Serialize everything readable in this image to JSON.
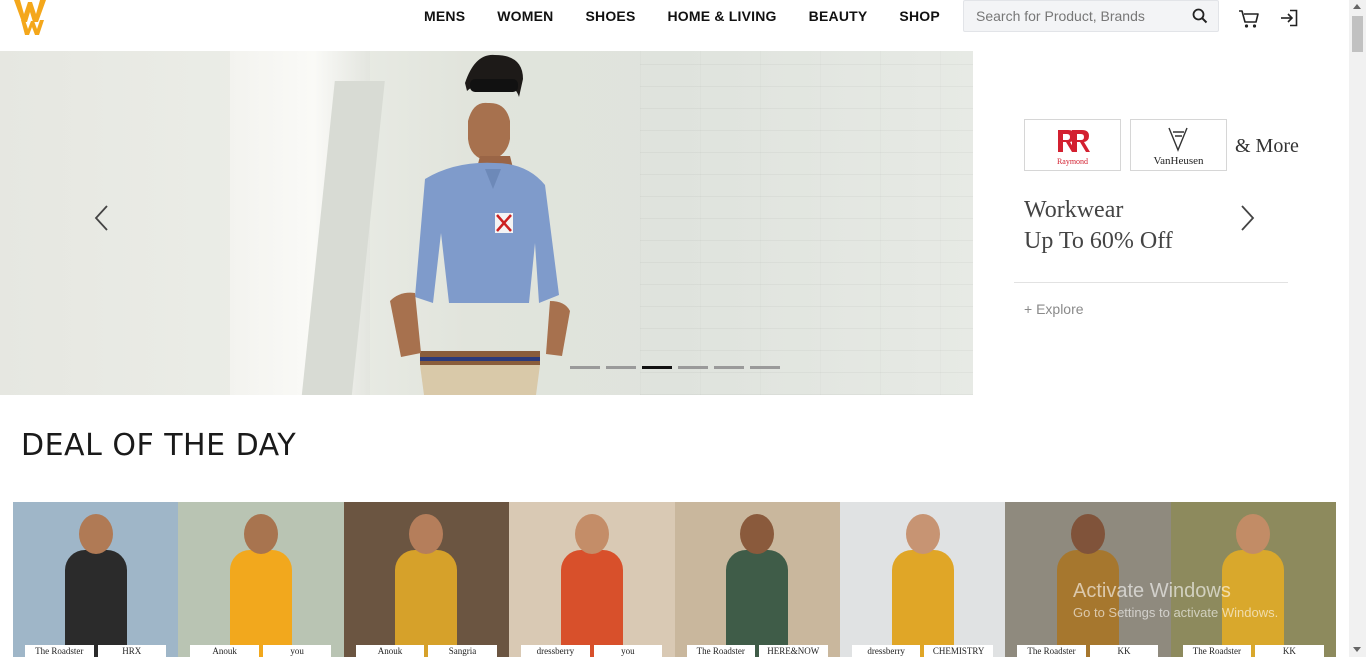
{
  "header": {
    "nav": [
      "MENS",
      "WOMEN",
      "SHOES",
      "HOME & LIVING",
      "BEAUTY",
      "SHOP"
    ],
    "search_placeholder": "Search for Product, Brands",
    "icons": [
      "ww-logo-icon",
      "search-icon",
      "cart-icon",
      "login-icon"
    ]
  },
  "hero": {
    "slide_index": 3,
    "slide_count": 6,
    "promo": {
      "brands": [
        "Raymond",
        "VanHeusen"
      ],
      "more": "& More",
      "title_line1": "Workwear",
      "title_line2": "Up To 60% Off",
      "explore": "+ Explore"
    }
  },
  "deal": {
    "title": "DEAL OF THE DAY",
    "products": [
      {
        "logos": [
          "The Roadster",
          "HRX"
        ],
        "bg": "#9fb6c8",
        "top": "#2b2b2b",
        "skin": "#b07a55"
      },
      {
        "logos": [
          "Anouk",
          "you"
        ],
        "bg": "#b9c4b3",
        "top": "#f2a81d",
        "skin": "#a8744f"
      },
      {
        "logos": [
          "Anouk",
          "Sangria"
        ],
        "bg": "#6b5541",
        "top": "#d6a12a",
        "skin": "#b57e5b"
      },
      {
        "logos": [
          "dressberry",
          "you"
        ],
        "bg": "#d9c9b4",
        "top": "#d8502b",
        "skin": "#c48d68"
      },
      {
        "logos": [
          "The Roadster",
          "HERE&NOW"
        ],
        "bg": "#c9b79d",
        "top": "#3f5c48",
        "skin": "#8a5a3c"
      },
      {
        "logos": [
          "dressberry",
          "CHEMISTRY"
        ],
        "bg": "#e0e2e3",
        "top": "#e0a627",
        "skin": "#c79473"
      },
      {
        "logos": [
          "The Roadster",
          "KK"
        ],
        "bg": "#8f8a7e",
        "top": "#a6772e",
        "skin": "#80533a"
      },
      {
        "logos": [
          "The Roadster",
          "KK"
        ],
        "bg": "#8d8a5d",
        "top": "#d9a82c",
        "skin": "#c28c66"
      }
    ]
  },
  "watermark": {
    "line1": "Activate Windows",
    "line2": "Go to Settings to activate Windows."
  },
  "colors": {
    "dot_active": "#111111",
    "dot": "#9a9a9a",
    "raymond_red": "#d32030"
  }
}
